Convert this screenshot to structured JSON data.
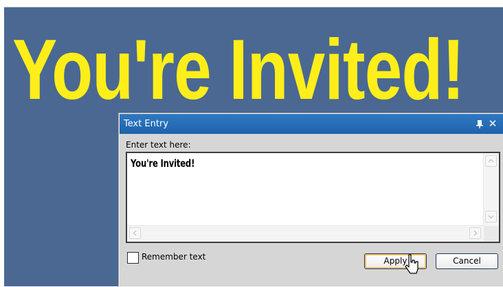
{
  "canvas": {
    "headline": "You're Invited!",
    "background_color": "#4a6892",
    "text_color": "#ffee1a"
  },
  "dialog": {
    "title": "Text Entry",
    "title_icons": [
      "pin-icon",
      "close-icon"
    ],
    "close_glyph": "✕",
    "prompt_label": "Enter text here:",
    "text_value": "You're Invited!",
    "remember_label": "Remember text",
    "remember_checked": false,
    "apply_label": "Apply",
    "cancel_label": "Cancel",
    "accent_color": "#1e63ab"
  }
}
